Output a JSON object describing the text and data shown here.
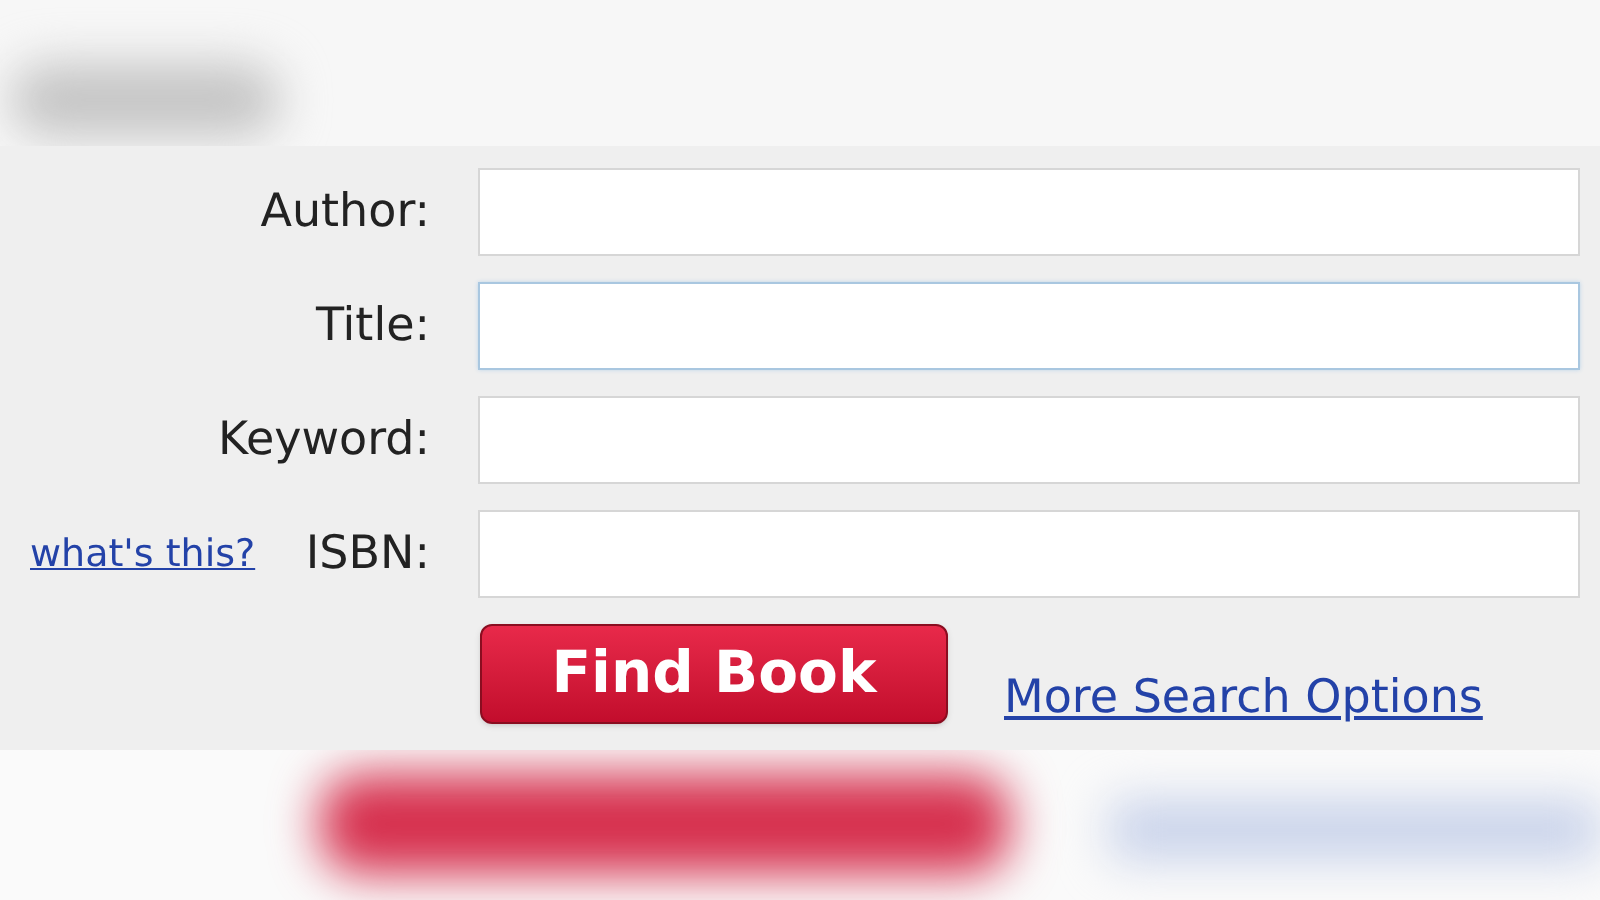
{
  "fields": [
    {
      "label": "Author:",
      "focused": false
    },
    {
      "label": "Title:",
      "focused": true
    },
    {
      "label": "Keyword:",
      "focused": false
    },
    {
      "label": "ISBN:",
      "focused": false,
      "help_link": "what's this?"
    }
  ],
  "find_button": "Find Book",
  "more_link": "More Search Options"
}
